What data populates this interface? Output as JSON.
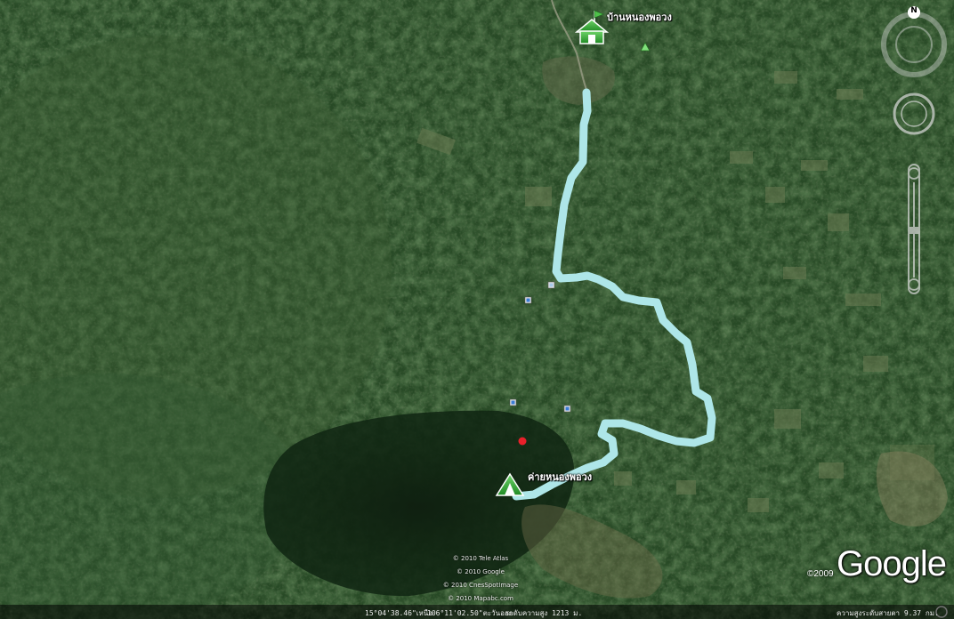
{
  "places": {
    "village": {
      "label": "บ้านหนองพอวง",
      "icon": "house-flag-icon"
    },
    "camp": {
      "label": "ค่ายหนองพอวง",
      "icon": "tent-icon"
    }
  },
  "markers": [
    "campground-triangle-icon",
    "info-square-icon",
    "info-square-icon",
    "info-square-icon",
    "info-square-icon",
    "red-dot-icon"
  ],
  "route_color": "#aee6e8",
  "attribution": [
    "© 2010 Tele Atlas",
    "© 2010 Google",
    "© 2010 CnesSpotImage",
    "© 2010 Mapabc.com"
  ],
  "status_bar": {
    "latitude": "15°04'38.46\"เหนือ",
    "longitude": "106°11'02.50\"ตะวันออก",
    "elevation": "ระดับความสูง 1213 ม.",
    "eye_altitude": "ความสูงระดับสายตา 9.37 กม."
  },
  "logo": {
    "copyright": "©2009",
    "text": "Google"
  },
  "compass": {
    "north_label": "N"
  }
}
